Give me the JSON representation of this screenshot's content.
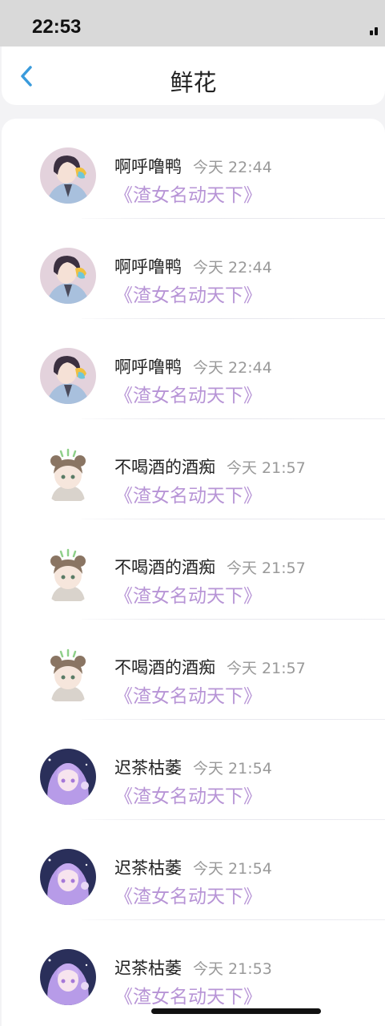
{
  "status_bar": {
    "time": "22:53"
  },
  "header": {
    "title": "鲜花",
    "back_icon": "chevron-left-icon"
  },
  "colors": {
    "accent": "#3a9bdc",
    "link": "#b794d6",
    "muted": "#999999"
  },
  "items": [
    {
      "user": "啊呼噜鸭",
      "time": "今天 22:44",
      "book": "《渣女名动天下》",
      "avatar": "anime-boy-avatar"
    },
    {
      "user": "啊呼噜鸭",
      "time": "今天 22:44",
      "book": "《渣女名动天下》",
      "avatar": "anime-boy-avatar"
    },
    {
      "user": "啊呼噜鸭",
      "time": "今天 22:44",
      "book": "《渣女名动天下》",
      "avatar": "anime-boy-avatar"
    },
    {
      "user": "不喝酒的酒痴",
      "time": "今天 21:57",
      "book": "《渣女名动天下》",
      "avatar": "raccoon-chibi-avatar"
    },
    {
      "user": "不喝酒的酒痴",
      "time": "今天 21:57",
      "book": "《渣女名动天下》",
      "avatar": "raccoon-chibi-avatar"
    },
    {
      "user": "不喝酒的酒痴",
      "time": "今天 21:57",
      "book": "《渣女名动天下》",
      "avatar": "raccoon-chibi-avatar"
    },
    {
      "user": "迟茶枯萎",
      "time": "今天 21:54",
      "book": "《渣女名动天下》",
      "avatar": "purple-hair-girl-avatar"
    },
    {
      "user": "迟茶枯萎",
      "time": "今天 21:54",
      "book": "《渣女名动天下》",
      "avatar": "purple-hair-girl-avatar"
    },
    {
      "user": "迟茶枯萎",
      "time": "今天 21:53",
      "book": "《渣女名动天下》",
      "avatar": "purple-hair-girl-avatar"
    }
  ]
}
